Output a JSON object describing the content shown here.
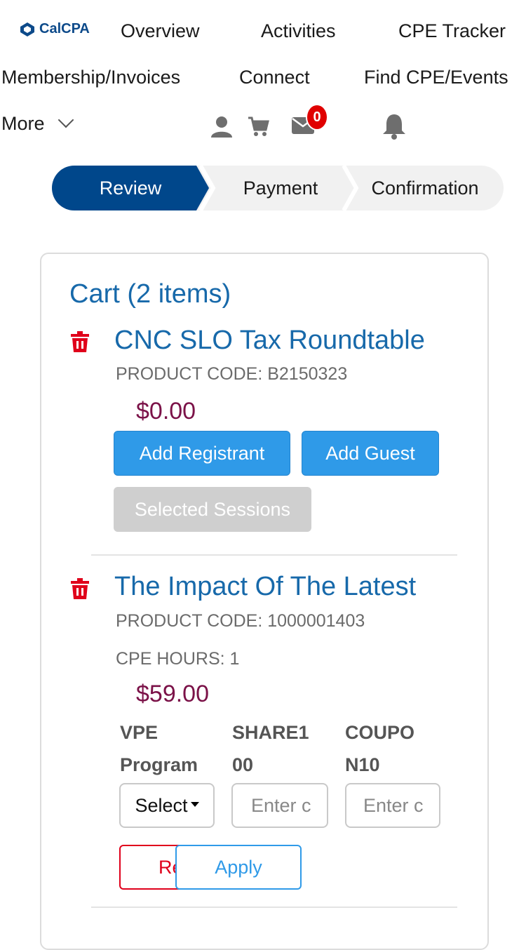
{
  "header": {
    "logo_text": "CalCPA",
    "nav": {
      "overview": "Overview",
      "activities": "Activities",
      "cpe_tracker": "CPE Tracker",
      "membership": "Membership/Invoices",
      "connect": "Connect",
      "find_cpe": "Find CPE/Events",
      "more": "More"
    },
    "icons": [
      "user-icon",
      "cart-icon",
      "mail-icon",
      "bell-icon"
    ],
    "mail_badge": "0"
  },
  "steps": {
    "review": "Review",
    "payment": "Payment",
    "confirmation": "Confirmation",
    "active": "review"
  },
  "cart": {
    "title": "Cart (2 items)",
    "items": [
      {
        "title": "CNC SLO Tax Roundtable",
        "product_code": "PRODUCT CODE: B2150323",
        "price": "$0.00",
        "add_registrant": "Add Registrant",
        "add_guest": "Add Guest",
        "selected_sessions": "Selected Sessions"
      },
      {
        "title": "The Impact Of The Latest",
        "product_code": "PRODUCT CODE: 1000001403",
        "cpe_hours": "CPE HOURS: 1",
        "price": "$59.00",
        "columns": [
          {
            "line1": "VPE",
            "line2": "Program"
          },
          {
            "line1": "SHARE1",
            "line2": "00"
          },
          {
            "line1": "COUPO",
            "line2": "N10"
          }
        ],
        "select_value": "Select",
        "input_placeholder": "Enter c",
        "remove_label": "Re",
        "apply_label": "Apply"
      }
    ]
  },
  "colors": {
    "brand": "#004a8c",
    "link": "#1769aa",
    "price": "#7b1248",
    "button": "#2f9ae8",
    "danger": "#e0001b"
  }
}
